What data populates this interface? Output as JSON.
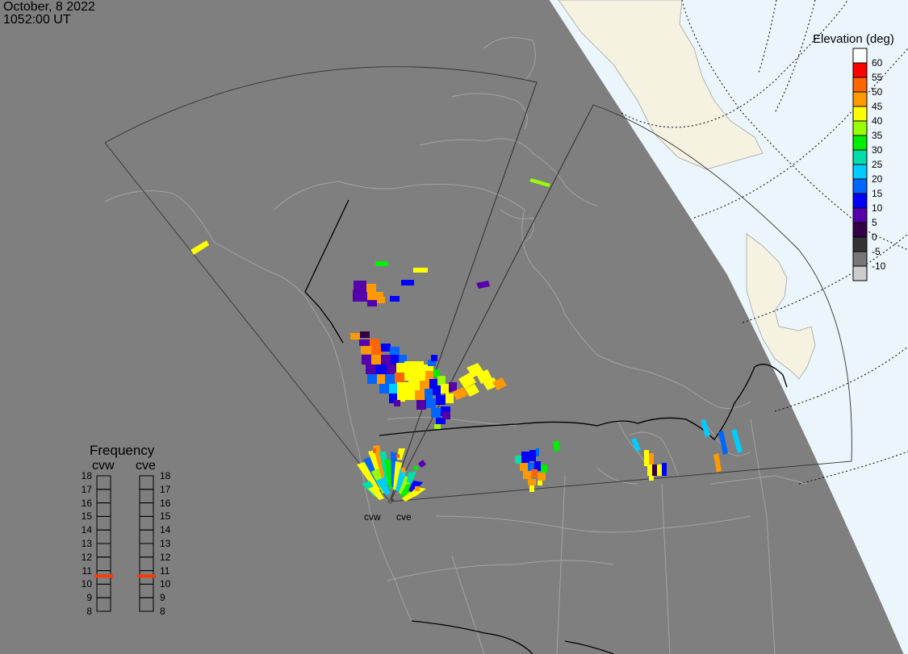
{
  "header": {
    "date": "October, 8 2022",
    "time": "1052:00 UT"
  },
  "colors": {
    "ocean": "#ebf5fc",
    "land_beyond": "#f5f2e1",
    "night": "#7f7f7f",
    "coast": "#a4a4a4",
    "border": "#000000",
    "fov": "#333333",
    "freq_marker": "#ff3b00"
  },
  "radars": {
    "cvw_label": "cvw",
    "cve_label": "cve"
  },
  "frequency": {
    "title": "Frequency",
    "cvw_label": "cvw",
    "cve_label": "cve",
    "ticks": [
      "18",
      "17",
      "16",
      "15",
      "14",
      "13",
      "12",
      "11",
      "10",
      "9",
      "8"
    ],
    "cvw_value": 10.6,
    "cve_value": 10.6
  },
  "elevation_scale": {
    "title": "Elevation (deg)",
    "bins": [
      {
        "label": "60",
        "color": "#ff0000"
      },
      {
        "label": "55",
        "color": "#ff6600"
      },
      {
        "label": "50",
        "color": "#ff9900"
      },
      {
        "label": "45",
        "color": "#ffff00"
      },
      {
        "label": "40",
        "color": "#99ff00"
      },
      {
        "label": "35",
        "color": "#00ee00"
      },
      {
        "label": "30",
        "color": "#00ddaa"
      },
      {
        "label": "25",
        "color": "#00ccff"
      },
      {
        "label": "20",
        "color": "#0066ff"
      },
      {
        "label": "15",
        "color": "#0000ff"
      },
      {
        "label": "10",
        "color": "#5500aa"
      },
      {
        "label": "5",
        "color": "#330044"
      },
      {
        "label": "0",
        "color": "#333333"
      },
      {
        "label": "-5",
        "color": "#777777"
      },
      {
        "label": "-10",
        "color": "#cccccc"
      }
    ]
  }
}
